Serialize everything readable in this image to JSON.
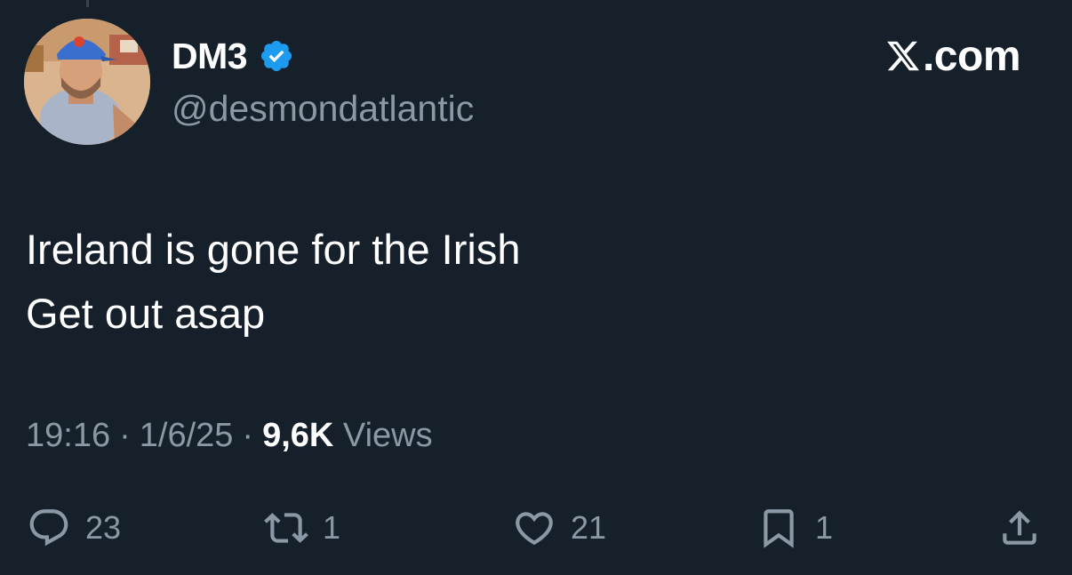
{
  "author": {
    "display_name": "DM3",
    "handle": "@desmondatlantic",
    "verified": true,
    "verified_color": "#1d9bf0",
    "avatar_icon": "avatar-photo"
  },
  "brand": {
    "logo_icon": "x-logo-icon",
    "text": ".com"
  },
  "tweet": {
    "lines": [
      "Ireland is gone for the Irish",
      "Get out asap"
    ]
  },
  "meta": {
    "time": "19:16",
    "separator": "·",
    "date": "1/6/25",
    "views_count": "9,6K",
    "views_label": "Views"
  },
  "actions": {
    "reply": {
      "icon": "reply-icon",
      "count": "23"
    },
    "retweet": {
      "icon": "retweet-icon",
      "count": "1"
    },
    "like": {
      "icon": "heart-icon",
      "count": "21"
    },
    "bookmark": {
      "icon": "bookmark-icon",
      "count": "1"
    },
    "share": {
      "icon": "share-icon"
    }
  },
  "colors": {
    "background": "#15202b",
    "primary_text": "#ffffff",
    "secondary_text": "#8b98a5",
    "accent": "#1d9bf0"
  }
}
